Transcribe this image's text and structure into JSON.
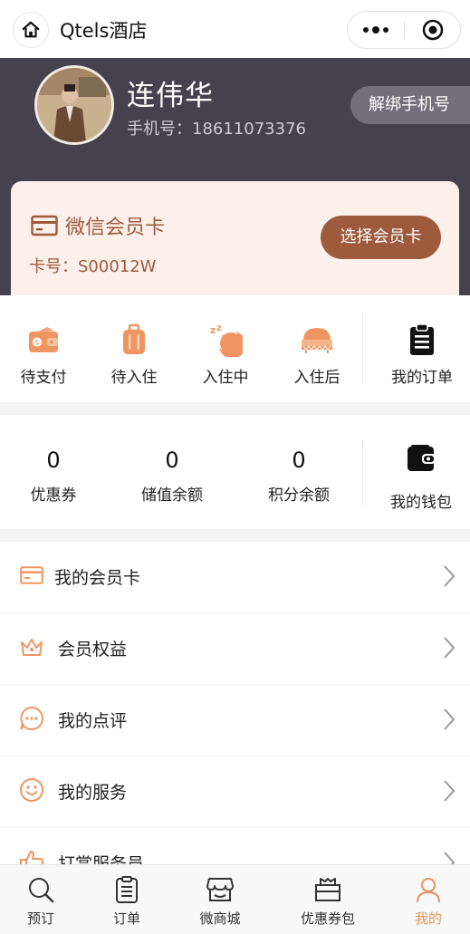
{
  "navbar": {
    "title": "Qtels酒店"
  },
  "profile": {
    "name": "连伟华",
    "phone_label": "手机号：",
    "phone": "18611073376",
    "unbind_label": "解绑手机号"
  },
  "member_card": {
    "title": "微信会员卡",
    "card_no_label": "卡号：",
    "card_no": "S00012W",
    "choose_label": "选择会员卡"
  },
  "orders": {
    "items": [
      {
        "label": "待支付",
        "icon": "wallet-pay-icon"
      },
      {
        "label": "待入住",
        "icon": "luggage-icon"
      },
      {
        "label": "入住中",
        "icon": "sleep-moon-icon"
      },
      {
        "label": "入住后",
        "icon": "bed-icon"
      }
    ],
    "my_orders_label": "我的订单"
  },
  "wallet": {
    "items": [
      {
        "value": "0",
        "label": "优惠券"
      },
      {
        "value": "0",
        "label": "储值余额"
      },
      {
        "value": "0",
        "label": "积分余额"
      }
    ],
    "my_wallet_label": "我的钱包"
  },
  "menu": {
    "items": [
      {
        "label": "我的会员卡",
        "icon": "card-icon"
      },
      {
        "label": "会员权益",
        "icon": "crown-icon"
      },
      {
        "label": "我的点评",
        "icon": "comment-icon"
      },
      {
        "label": "我的服务",
        "icon": "smile-icon"
      },
      {
        "label": "打赏服务员",
        "icon": "thumbs-up-icon"
      }
    ]
  },
  "tabbar": {
    "items": [
      {
        "label": "预订",
        "icon": "search-icon"
      },
      {
        "label": "订单",
        "icon": "list-icon"
      },
      {
        "label": "微商城",
        "icon": "shop-icon"
      },
      {
        "label": "优惠券包",
        "icon": "coupon-bag-icon"
      },
      {
        "label": "我的",
        "icon": "user-icon"
      }
    ],
    "active_index": 4
  },
  "colors": {
    "accent": "#e9915d",
    "card_brown": "#9d5a3d",
    "header_bg": "#46414e",
    "card_bg": "#fdf0ea"
  }
}
